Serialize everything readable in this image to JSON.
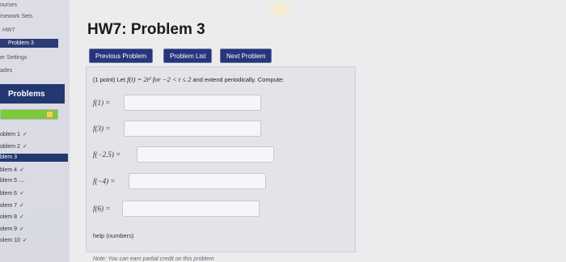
{
  "sidebar": {
    "links": [
      "ourses",
      "mework Sets",
      "HW7",
      "Problem 3",
      "er Settings",
      "ades"
    ],
    "problems_header": "Problems",
    "problem_items": [
      {
        "label": "oblem 1",
        "check": "✓",
        "current": false
      },
      {
        "label": "oblem 2",
        "check": "✓",
        "current": false
      },
      {
        "label": "blem 3",
        "check": "",
        "current": true
      },
      {
        "label": "blem 4",
        "check": "✓",
        "current": false
      },
      {
        "label": "blem 5",
        "check": "...",
        "current": false
      },
      {
        "label": "blem 6",
        "check": "✓",
        "current": false
      },
      {
        "label": "olem 7",
        "check": "✓",
        "current": false
      },
      {
        "label": "olem 8",
        "check": "✓",
        "current": false
      },
      {
        "label": "olem 9",
        "check": "✓",
        "current": false
      },
      {
        "label": "olem 10",
        "check": "✓",
        "current": false
      }
    ],
    "progress_fraction": 0.8
  },
  "main": {
    "title": "HW7: Problem 3",
    "buttons": {
      "previous": "Previous Problem",
      "list": "Problem List",
      "next": "Next Problem"
    },
    "prompt": {
      "prefix": "(1 point) Let",
      "formula": "f(t) = 2t² for −2 < t ≤ 2",
      "suffix": "and extend periodically. Compute:"
    },
    "rows": [
      {
        "label": "f(1) =",
        "value": ""
      },
      {
        "label": "f(3) =",
        "value": ""
      },
      {
        "label": "f(−2.5) =",
        "value": ""
      },
      {
        "label": "f(−4) =",
        "value": ""
      },
      {
        "label": "f(6) =",
        "value": ""
      }
    ],
    "help": "help (numbers)",
    "note": "Note: You can earn partial credit on this problem"
  },
  "colors": {
    "accent": "#27357c",
    "selected": "#233771",
    "progress_green": "#7acb3b",
    "progress_yellow": "#e8d94a"
  }
}
